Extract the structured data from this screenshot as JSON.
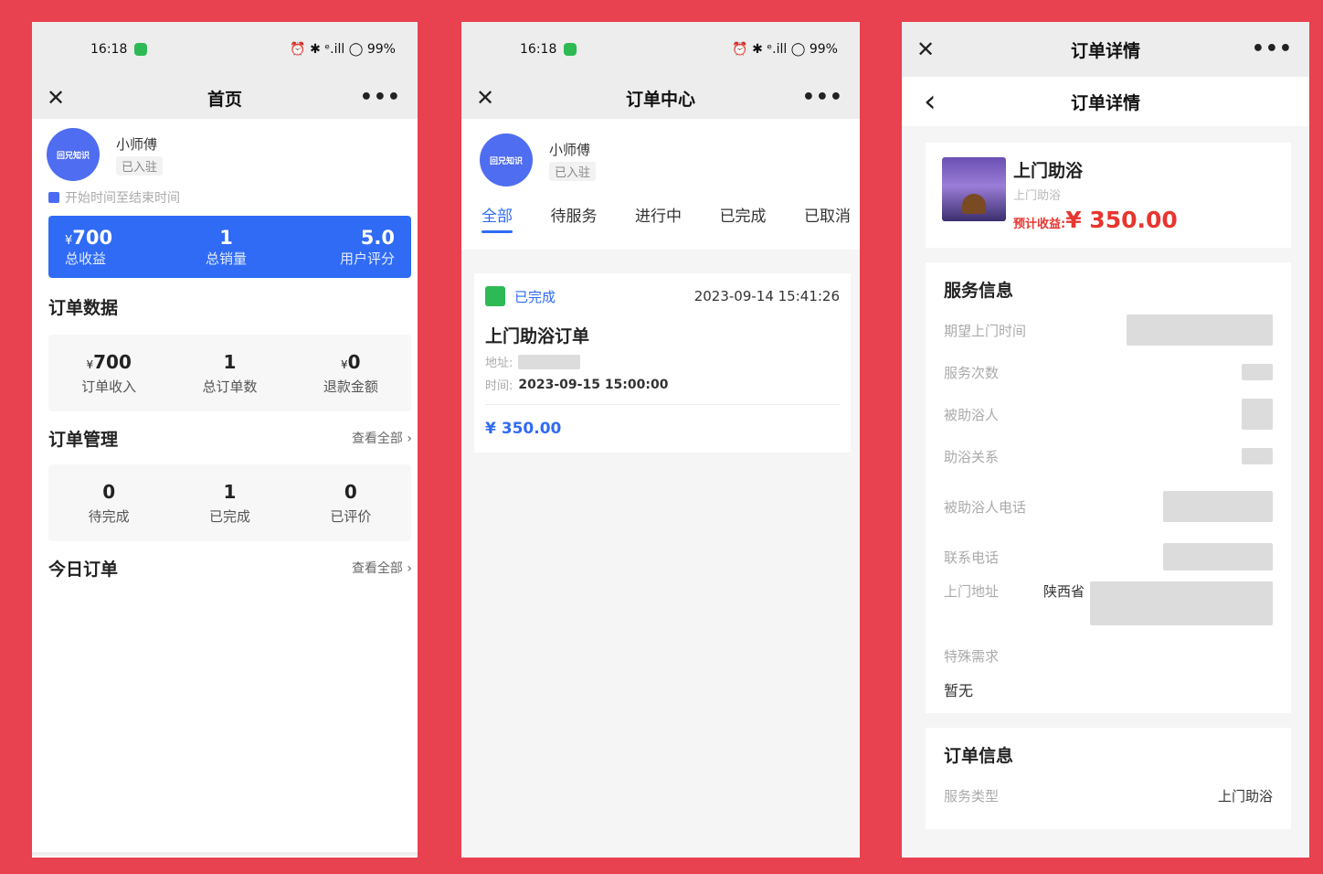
{
  "status_bar": {
    "time": "16:18",
    "indicators": "⏰ ✱ ᵉ.ill ◯ 99%"
  },
  "screen1": {
    "close_icon": "✕",
    "title": "首页",
    "more_icon": "•••",
    "avatar_text": "回兄知识",
    "name": "小师傅",
    "tag": "已入驻",
    "date_range": "开始时间至结束时间",
    "summary": [
      {
        "currency": "¥",
        "value": "700",
        "label": "总收益"
      },
      {
        "currency": "",
        "value": "1",
        "label": "总销量"
      },
      {
        "currency": "",
        "value": "5.0",
        "label": "用户评分"
      }
    ],
    "order_data_title": "订单数据",
    "order_data": [
      {
        "currency": "¥",
        "value": "700",
        "label": "订单收入"
      },
      {
        "currency": "",
        "value": "1",
        "label": "总订单数"
      },
      {
        "currency": "¥",
        "value": "0",
        "label": "退款金额"
      }
    ],
    "order_manage_title": "订单管理",
    "view_all": "查看全部 ›",
    "order_manage": [
      {
        "value": "0",
        "label": "待完成"
      },
      {
        "value": "1",
        "label": "已完成"
      },
      {
        "value": "0",
        "label": "已评价"
      }
    ],
    "today_orders_title": "今日订单",
    "view_all_2": "查看全部 ›"
  },
  "screen2": {
    "close_icon": "✕",
    "title": "订单中心",
    "more_icon": "•••",
    "avatar_text": "回兄知识",
    "name": "小师傅",
    "tag": "已入驻",
    "tabs": [
      "全部",
      "待服务",
      "进行中",
      "已完成",
      "已取消"
    ],
    "order": {
      "status": "已完成",
      "created": "2023-09-14 15:41:26",
      "title": "上门助浴订单",
      "address_label": "地址:",
      "time_label": "时间:",
      "time": "2023-09-15 15:00:00",
      "price": "¥ 350.00"
    }
  },
  "screen3": {
    "close_icon": "✕",
    "top_title": "订单详情",
    "more_icon": "•••",
    "back_icon": "‹",
    "title": "订单详情",
    "product": {
      "name": "上门助浴",
      "sub": "上门助浴",
      "income_label": "预计收益:",
      "income": "¥ 350.00"
    },
    "service_title": "服务信息",
    "service_rows": [
      {
        "label": "期望上门时间",
        "value": ""
      },
      {
        "label": "服务次数",
        "value": ""
      },
      {
        "label": "被助浴人",
        "value": ""
      },
      {
        "label": "助浴关系",
        "value": ""
      },
      {
        "label": "被助浴人电话",
        "value": ""
      },
      {
        "label": "联系电话",
        "value": ""
      },
      {
        "label": "上门地址",
        "value": "陕西省"
      },
      {
        "label": "特殊需求",
        "value": ""
      }
    ],
    "special_value": "暂无",
    "order_info_title": "订单信息",
    "order_rows": [
      {
        "label": "服务类型",
        "value": "上门助浴"
      }
    ]
  },
  "colors": {
    "background": "#E8414F",
    "accent": "#2F6BF5",
    "price": "#E8352F",
    "success": "#2DBA55"
  }
}
